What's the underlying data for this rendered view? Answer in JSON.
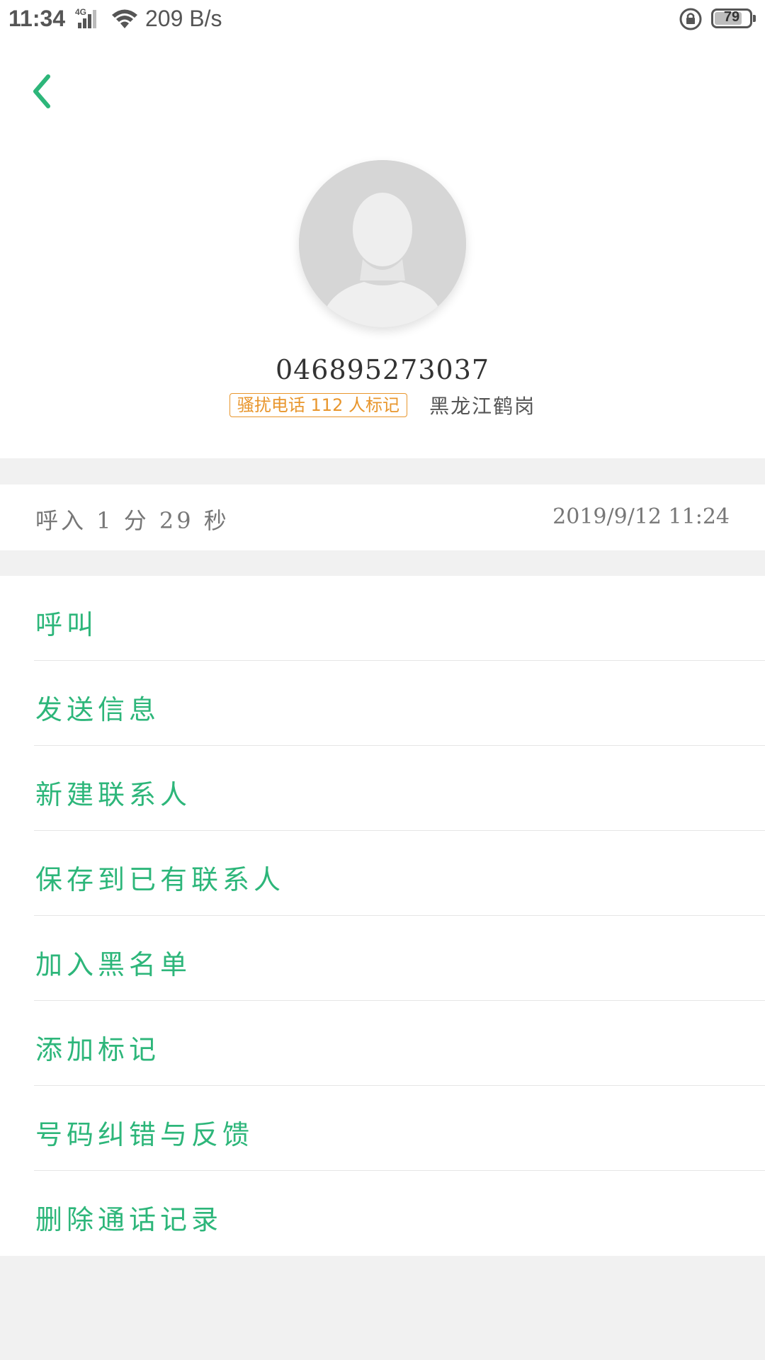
{
  "status_bar": {
    "time": "11:34",
    "network_type": "4G",
    "speed": "209 B/s",
    "battery": "79",
    "battery_level": 0.79
  },
  "header": {
    "phone_number": "046895273037",
    "spam_badge": "骚扰电话 112 人标记",
    "location": "黑龙江鹤岗"
  },
  "call_record": {
    "description": "呼入 1 分 29 秒",
    "datetime": "2019/9/12 11:24"
  },
  "actions": [
    {
      "label": "呼叫"
    },
    {
      "label": "发送信息"
    },
    {
      "label": "新建联系人"
    },
    {
      "label": "保存到已有联系人"
    },
    {
      "label": "加入黑名单"
    },
    {
      "label": "添加标记"
    },
    {
      "label": "号码纠错与反馈"
    },
    {
      "label": "删除通话记录"
    }
  ],
  "colors": {
    "accent": "#2db67a",
    "badge": "#e8962d",
    "background": "#f1f1f1"
  }
}
